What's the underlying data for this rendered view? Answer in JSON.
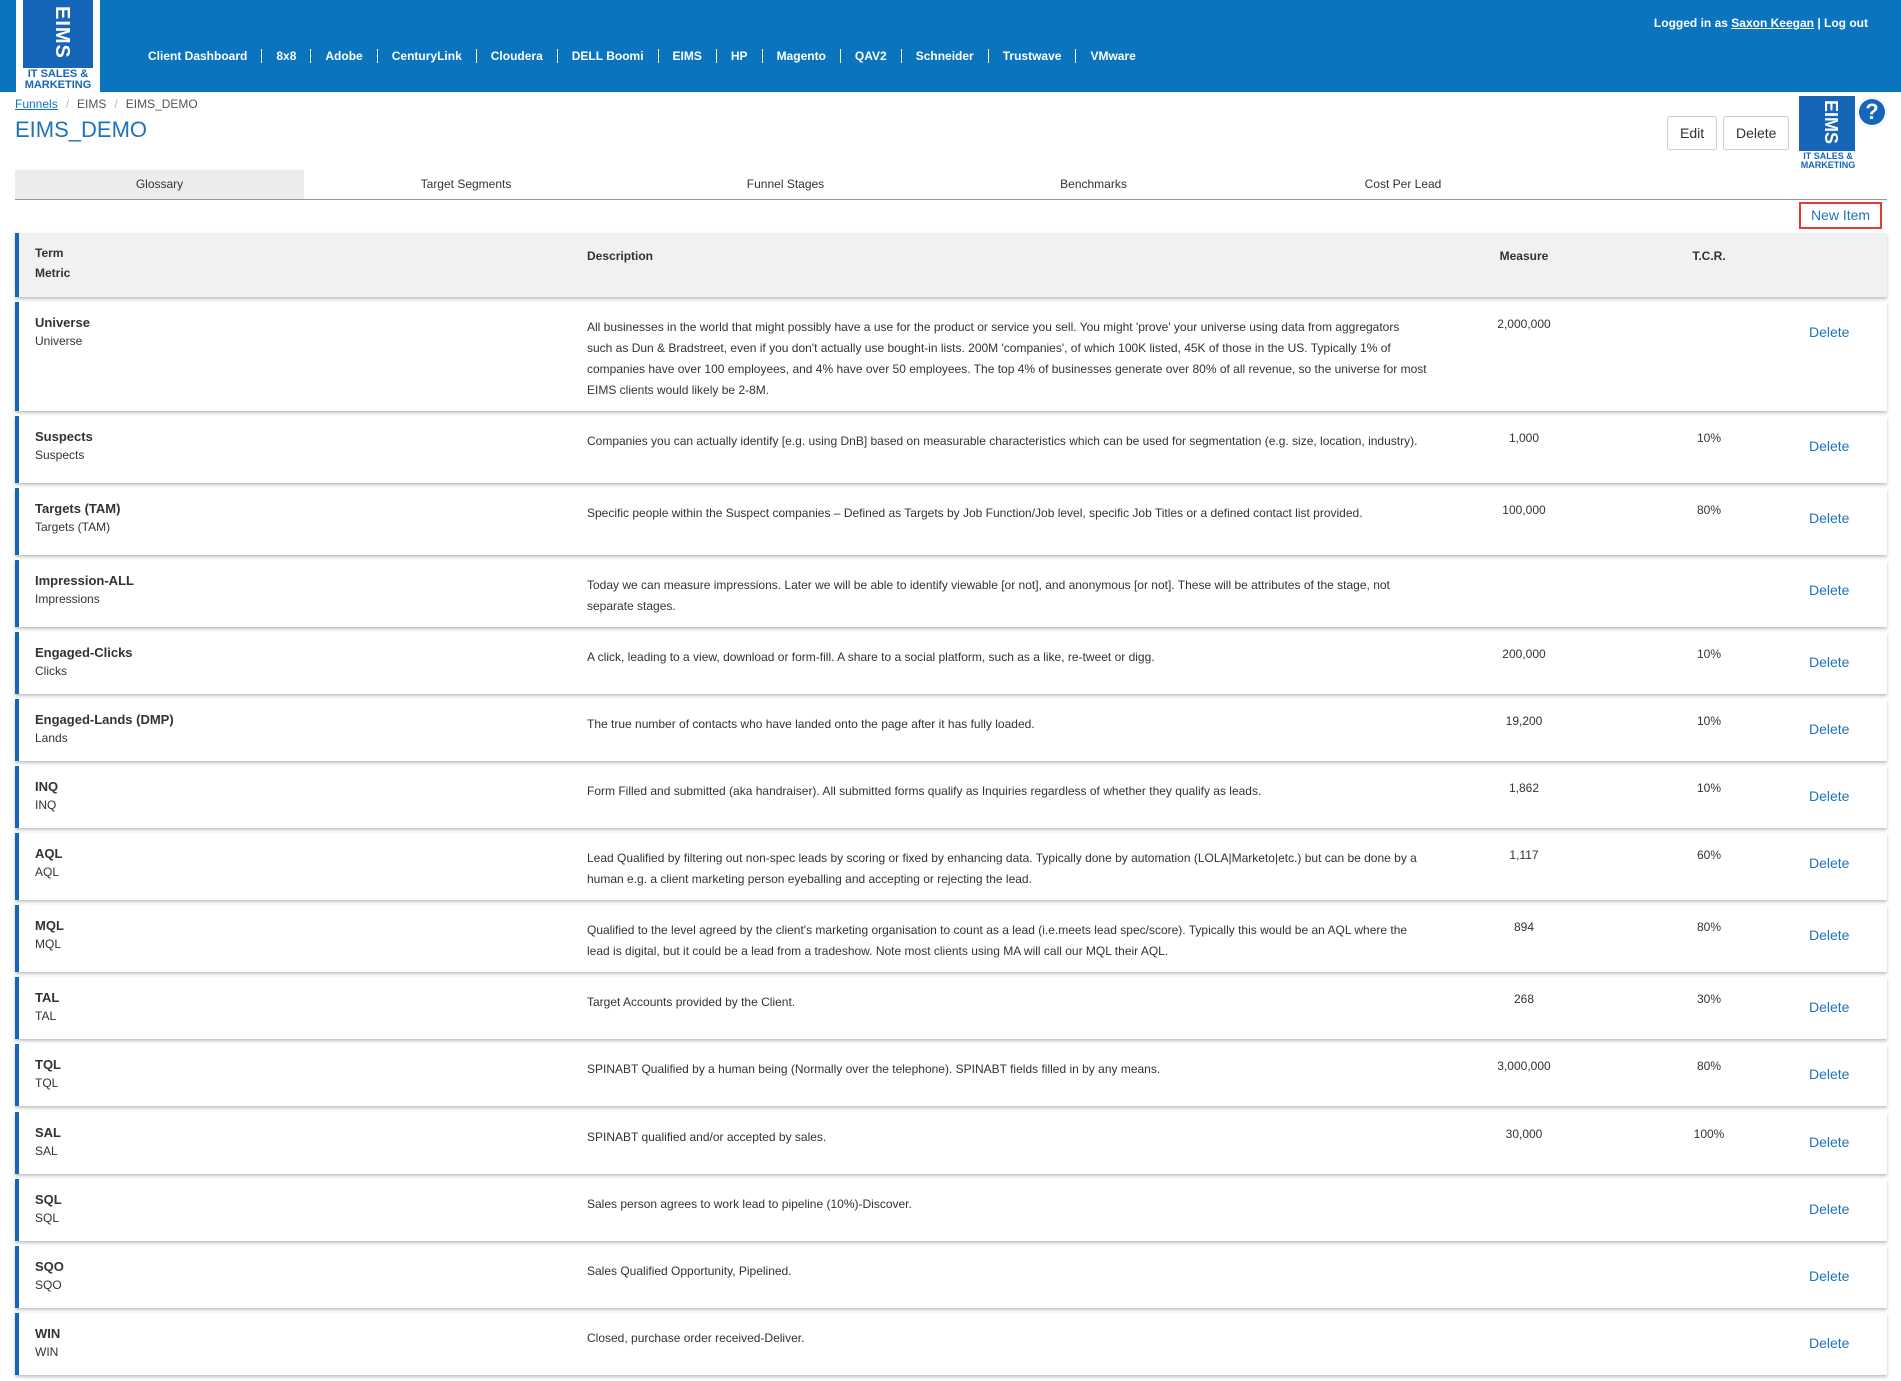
{
  "nav": {
    "logo_text": "EIMS",
    "logo_sub": "IT SALES & MARKETING",
    "items": [
      "Client Dashboard",
      "8x8",
      "Adobe",
      "CenturyLink",
      "Cloudera",
      "DELL Boomi",
      "EIMS",
      "HP",
      "Magento",
      "QAV2",
      "Schneider",
      "Trustwave",
      "VMware"
    ],
    "login_prefix": "Logged in as",
    "user": "Saxon Keegan",
    "logout": "Log out",
    "separator": "|"
  },
  "breadcrumb": {
    "root": "Funnels",
    "mid": "EIMS",
    "current": "EIMS_DEMO",
    "sep": "/"
  },
  "page": {
    "title": "EIMS_DEMO",
    "edit_label": "Edit",
    "delete_label": "Delete",
    "help_symbol": "?"
  },
  "tabs": [
    "Glossary",
    "Target Segments",
    "Funnel Stages",
    "Benchmarks",
    "Cost Per Lead"
  ],
  "new_item_label": "New Item",
  "table": {
    "header": {
      "term": "Term",
      "metric": "Metric",
      "description": "Description",
      "measure": "Measure",
      "tcr": "T.C.R."
    },
    "delete_label": "Delete",
    "rows": [
      {
        "term": "Universe",
        "metric": "Universe",
        "description": "All businesses in the world that might possibly have a use for the product or service you sell. You might 'prove' your universe using data from aggregators such as Dun & Bradstreet, even if you don't actually use bought-in lists. 200M 'companies', of which 100K listed, 45K of those in the US. Typically 1% of companies have over 100 employees, and 4% have over 50 employees. The top 4% of businesses generate over 80% of all revenue, so the universe for most EIMS clients would likely be 2-8M.",
        "measure": "2,000,000",
        "tcr": ""
      },
      {
        "term": "Suspects",
        "metric": "Suspects",
        "description": "Companies you can actually identify [e.g. using DnB] based on measurable characteristics which can be used for segmentation (e.g. size, location, industry).",
        "measure": "1,000",
        "tcr": "10%"
      },
      {
        "term": "Targets (TAM)",
        "metric": "Targets (TAM)",
        "description": "Specific people within the Suspect companies – Defined as Targets by Job Function/Job level, specific Job Titles or a defined contact list provided.",
        "measure": "100,000",
        "tcr": "80%"
      },
      {
        "term": "Impression-ALL",
        "metric": "Impressions",
        "description": "Today we can measure impressions. Later we will be able to identify viewable [or not], and anonymous [or not]. These will be attributes of the stage, not separate stages.",
        "measure": "",
        "tcr": ""
      },
      {
        "term": "Engaged-Clicks",
        "metric": "Clicks",
        "description": "A click, leading to a view, download or form-fill. A share to a social platform, such as a like, re-tweet or digg.",
        "measure": "200,000",
        "tcr": "10%"
      },
      {
        "term": "Engaged-Lands (DMP)",
        "metric": "Lands",
        "description": "The true number of contacts who have landed onto the page after it has fully loaded.",
        "measure": "19,200",
        "tcr": "10%"
      },
      {
        "term": "INQ",
        "metric": "INQ",
        "description": "Form Filled and submitted (aka handraiser). All submitted forms qualify as Inquiries regardless of whether they qualify as leads.",
        "measure": "1,862",
        "tcr": "10%"
      },
      {
        "term": "AQL",
        "metric": "AQL",
        "description": "Lead Qualified by filtering out non-spec leads by scoring or fixed by enhancing data. Typically done by automation (LOLA|Marketo|etc.) but can be done by a human e.g. a client marketing person eyeballing and accepting or rejecting the lead.",
        "measure": "1,117",
        "tcr": "60%"
      },
      {
        "term": "MQL",
        "metric": "MQL",
        "description": "Qualified to the level agreed by the client's marketing organisation to count as a lead (i.e.meets lead spec/score). Typically this would be an AQL where the lead is digital, but it could be a lead from a tradeshow. Note most clients using MA will call our MQL their AQL.",
        "measure": "894",
        "tcr": "80%"
      },
      {
        "term": "TAL",
        "metric": "TAL",
        "description": "Target Accounts provided by the Client.",
        "measure": "268",
        "tcr": "30%"
      },
      {
        "term": "TQL",
        "metric": "TQL",
        "description": "SPINABT Qualified by a human being (Normally over the telephone). SPINABT fields filled in by any means.",
        "measure": "3,000,000",
        "tcr": "80%"
      },
      {
        "term": "SAL",
        "metric": "SAL",
        "description": "SPINABT qualified and/or accepted by sales.",
        "measure": "30,000",
        "tcr": "100%"
      },
      {
        "term": "SQL",
        "metric": "SQL",
        "description": "Sales person agrees to work lead to pipeline (10%)-Discover.",
        "measure": "",
        "tcr": ""
      },
      {
        "term": "SQO",
        "metric": "SQO",
        "description": "Sales Qualified Opportunity, Pipelined.",
        "measure": "",
        "tcr": ""
      },
      {
        "term": "WIN",
        "metric": "WIN",
        "description": "Closed, purchase order received-Deliver.",
        "measure": "",
        "tcr": ""
      }
    ]
  }
}
